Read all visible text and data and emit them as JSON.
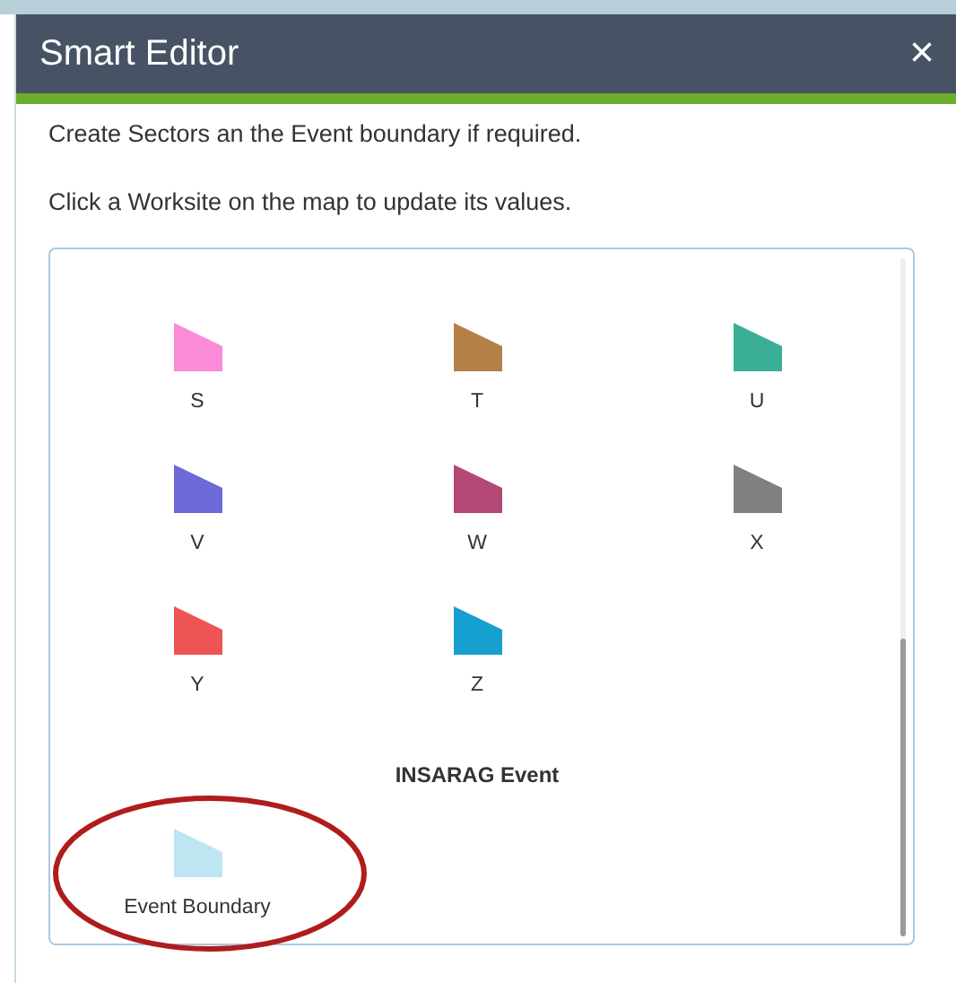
{
  "window": {
    "title": "Smart Editor",
    "close": "×"
  },
  "instructions": [
    "Create Sectors an the Event boundary if required.",
    "Click a Worksite on the map to update its values."
  ],
  "templates": [
    {
      "label": "S",
      "color": "#f98bd8"
    },
    {
      "label": "T",
      "color": "#b57f48"
    },
    {
      "label": "U",
      "color": "#3aae96"
    },
    {
      "label": "V",
      "color": "#6b6ad6"
    },
    {
      "label": "W",
      "color": "#b44875"
    },
    {
      "label": "X",
      "color": "#808080"
    },
    {
      "label": "Y",
      "color": "#ee5454"
    },
    {
      "label": "Z",
      "color": "#16a0cf"
    }
  ],
  "section": {
    "title": "INSARAG Event",
    "templates": [
      {
        "label": "Event Boundary",
        "color": "#bde6f2",
        "highlighted": true
      }
    ]
  }
}
